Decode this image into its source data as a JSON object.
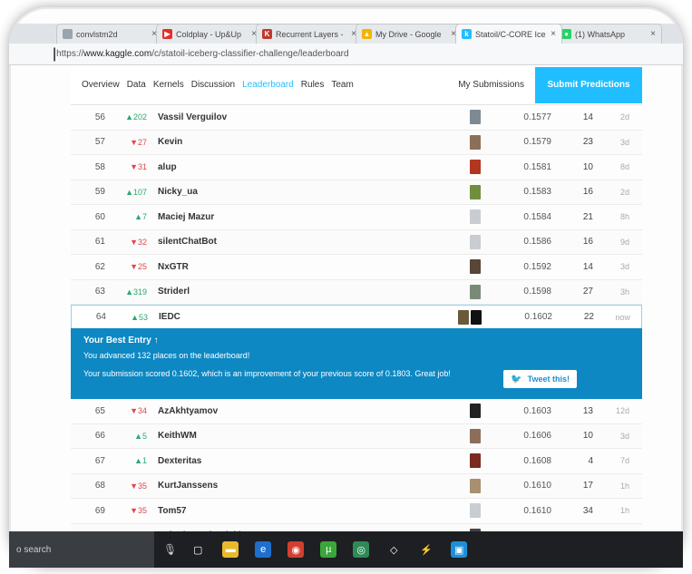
{
  "browser": {
    "tabs": [
      {
        "title": "convlstm2d",
        "fav_color": "#9aa4ad",
        "fav_glyph": ""
      },
      {
        "title": "Coldplay - Up&Up",
        "fav_color": "#e52d27",
        "fav_glyph": "▶"
      },
      {
        "title": "Recurrent Layers -",
        "fav_color": "#c0392b",
        "fav_glyph": "K"
      },
      {
        "title": "My Drive - Google",
        "fav_color": "#f4b400",
        "fav_glyph": "▲"
      },
      {
        "title": "Statoil/C-CORE Ice",
        "fav_color": "#20beff",
        "fav_glyph": "k"
      },
      {
        "title": "(1) WhatsApp",
        "fav_color": "#25d366",
        "fav_glyph": "●"
      }
    ],
    "url_prefix": "https://",
    "url_host": "www.kaggle.com",
    "url_path": "/c/statoil-iceberg-classifier-challenge/leaderboard"
  },
  "nav": {
    "items": [
      "Overview",
      "Data",
      "Kernels",
      "Discussion",
      "Leaderboard",
      "Rules",
      "Team"
    ],
    "active_index": 4,
    "my_submissions": "My Submissions",
    "submit_label": "Submit Predictions"
  },
  "leaderboard": {
    "rows_before": [
      {
        "rank": "56",
        "change": "▲202",
        "dir": "up",
        "name": "Vassil Verguilov",
        "avatars": [
          "#7d8a94"
        ],
        "score": "0.1577",
        "entries": "14",
        "last": "2d"
      },
      {
        "rank": "57",
        "change": "▼27",
        "dir": "down",
        "name": "Kevin",
        "avatars": [
          "#8c6f5a"
        ],
        "score": "0.1579",
        "entries": "23",
        "last": "3d"
      },
      {
        "rank": "58",
        "change": "▼31",
        "dir": "down",
        "name": "alup",
        "avatars": [
          "#b3361f"
        ],
        "score": "0.1581",
        "entries": "10",
        "last": "8d"
      },
      {
        "rank": "59",
        "change": "▲107",
        "dir": "up",
        "name": "Nicky_ua",
        "avatars": [
          "#6f8f3d"
        ],
        "score": "0.1583",
        "entries": "16",
        "last": "2d"
      },
      {
        "rank": "60",
        "change": "▲7",
        "dir": "up",
        "name": "Maciej Mazur",
        "avatars": [
          "#c9cdd1"
        ],
        "score": "0.1584",
        "entries": "21",
        "last": "8h"
      },
      {
        "rank": "61",
        "change": "▼32",
        "dir": "down",
        "name": "silentChatBot",
        "avatars": [
          "#c9cdd1"
        ],
        "score": "0.1586",
        "entries": "16",
        "last": "9d"
      },
      {
        "rank": "62",
        "change": "▼25",
        "dir": "down",
        "name": "NxGTR",
        "avatars": [
          "#5a4636"
        ],
        "score": "0.1592",
        "entries": "14",
        "last": "3d"
      },
      {
        "rank": "63",
        "change": "▲319",
        "dir": "up",
        "name": "Striderl",
        "avatars": [
          "#7a8a78"
        ],
        "score": "0.1598",
        "entries": "27",
        "last": "3h"
      },
      {
        "rank": "64",
        "change": "▲53",
        "dir": "up",
        "name": "IEDC",
        "avatars": [
          "#6b5a3a",
          "#111111"
        ],
        "score": "0.1602",
        "entries": "22",
        "last": "now",
        "highlight": true
      }
    ],
    "rows_after": [
      {
        "rank": "65",
        "change": "▼34",
        "dir": "down",
        "name": "AzAkhtyamov",
        "avatars": [
          "#222222"
        ],
        "score": "0.1603",
        "entries": "13",
        "last": "12d"
      },
      {
        "rank": "66",
        "change": "▲5",
        "dir": "up",
        "name": "KeithWM",
        "avatars": [
          "#8c6f5a"
        ],
        "score": "0.1606",
        "entries": "10",
        "last": "3d"
      },
      {
        "rank": "67",
        "change": "▲1",
        "dir": "up",
        "name": "Dexteritas",
        "avatars": [
          "#7a2a1f"
        ],
        "score": "0.1608",
        "entries": "4",
        "last": "7d"
      },
      {
        "rank": "68",
        "change": "▼35",
        "dir": "down",
        "name": "KurtJanssens",
        "avatars": [
          "#a89070"
        ],
        "score": "0.1610",
        "entries": "17",
        "last": "1h"
      },
      {
        "rank": "69",
        "change": "▼35",
        "dir": "down",
        "name": "Tom57",
        "avatars": [
          "#c9cdd1"
        ],
        "score": "0.1610",
        "entries": "34",
        "last": "1h"
      },
      {
        "rank": "70",
        "change": "▼20",
        "dir": "down",
        "name": "Lefteris Fanioudakis",
        "avatars": [
          "#444444"
        ],
        "score": "0.1616",
        "entries": "39",
        "last": "1d"
      }
    ]
  },
  "best_entry": {
    "title": "Your Best Entry ↑",
    "advanced": "You advanced 132 places on the leaderboard!",
    "scored": "Your submission scored 0.1602, which is an improvement of your previous score of 0.1803. Great job!",
    "tweet_label": "Tweet this!"
  },
  "taskbar": {
    "search_placeholder": "o search",
    "icons": [
      {
        "name": "task-view-icon",
        "glyph": "▢",
        "color": "transparent"
      },
      {
        "name": "file-explorer-icon",
        "glyph": "▬",
        "color": "#e8b92f"
      },
      {
        "name": "edge-icon",
        "glyph": "e",
        "color": "#1f6fcf"
      },
      {
        "name": "chrome-icon",
        "glyph": "◉",
        "color": "#d23f31"
      },
      {
        "name": "utorrent-icon",
        "glyph": "µ",
        "color": "#3aa63c"
      },
      {
        "name": "app-green-icon",
        "glyph": "◎",
        "color": "#2e8b57"
      },
      {
        "name": "box-icon",
        "glyph": "◇",
        "color": "transparent"
      },
      {
        "name": "network-icon",
        "glyph": "⚡",
        "color": "transparent"
      },
      {
        "name": "remote-icon",
        "glyph": "▣",
        "color": "#1e90d8"
      }
    ]
  }
}
